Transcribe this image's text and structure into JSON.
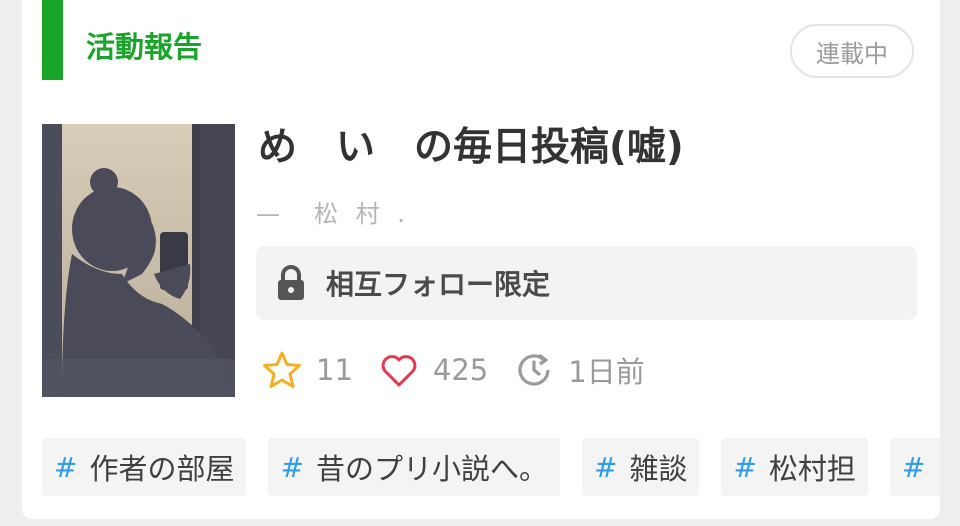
{
  "category": {
    "label": "活動報告"
  },
  "status": {
    "label": "連載中"
  },
  "work": {
    "title": "め　い　の毎日投稿(嘘)",
    "author": "—　松 村 ."
  },
  "restriction": {
    "icon": "lock-icon",
    "label": "相互フォロー限定"
  },
  "stats": {
    "stars": "11",
    "likes": "425",
    "updated": "1日前"
  },
  "tags": [
    {
      "hash": "#",
      "text": "作者の部屋"
    },
    {
      "hash": "#",
      "text": "昔のプリ小説へ。"
    },
    {
      "hash": "#",
      "text": "雑談"
    },
    {
      "hash": "#",
      "text": "松村担"
    },
    {
      "hash": "#",
      "text": ""
    }
  ],
  "colors": {
    "accent_green": "#18a52a",
    "star": "#f5b021",
    "heart": "#e8384f",
    "hash": "#2d9df0"
  }
}
